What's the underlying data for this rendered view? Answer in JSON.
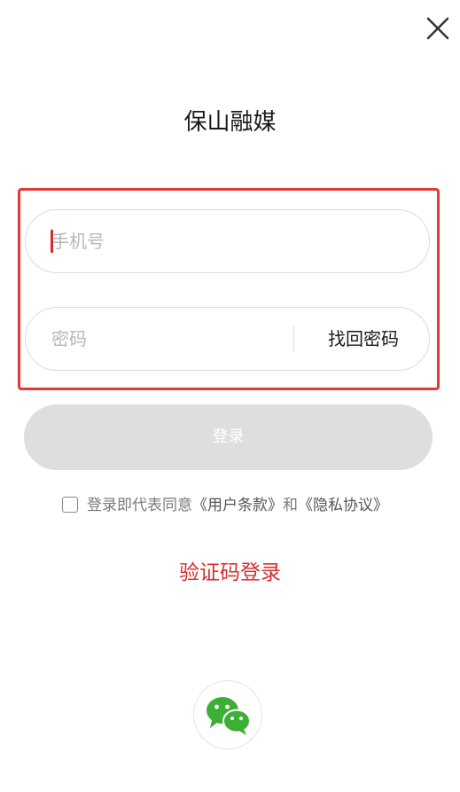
{
  "header": {
    "close_icon": "close-icon",
    "app_title": "保山融媒"
  },
  "login_form": {
    "phone_placeholder": "手机号",
    "password_placeholder": "密码",
    "recover_password_label": "找回密码",
    "highlight_color": "#e53935"
  },
  "actions": {
    "login_label": "登录",
    "login_button_color": "#dedede",
    "sms_login_label": "验证码登录",
    "sms_login_color": "#d32f2f"
  },
  "agreement": {
    "checked": false,
    "prefix": "登录即代表同意",
    "user_terms": "《用户条款》",
    "conjunction": "和",
    "privacy_policy": "《隐私协议》"
  },
  "social": {
    "wechat_icon": "wechat-icon",
    "wechat_color": "#3cb034"
  }
}
